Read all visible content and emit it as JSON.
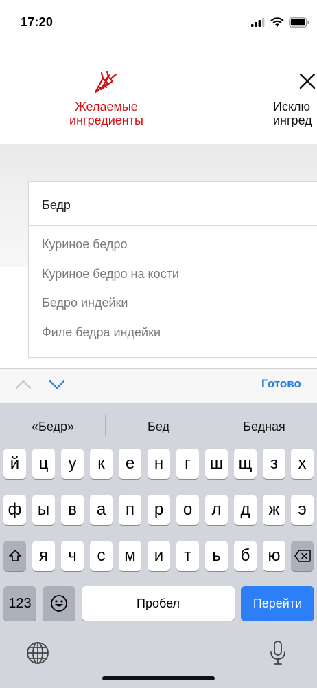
{
  "status_bar": {
    "time": "17:20"
  },
  "tabs": {
    "desired": {
      "line1": "Желаемые",
      "line2": "ингредиенты",
      "icon": "carrot-icon",
      "color": "#d50f12"
    },
    "exclude": {
      "line1": "Исклю",
      "line2": "ингред",
      "icon": "close-icon"
    }
  },
  "search": {
    "value": "Бедр",
    "suggestions": [
      "Куриное бедро",
      "Куриное бедро на кости",
      "Бедро индейки",
      "Филе бедра индейки"
    ]
  },
  "toolbar": {
    "done_label": "Готово",
    "accent": "#2a7be4"
  },
  "keyboard": {
    "predictions": [
      "«Бедр»",
      "Бед",
      "Бедная"
    ],
    "row1": [
      "й",
      "ц",
      "у",
      "к",
      "е",
      "н",
      "г",
      "ш",
      "щ",
      "з",
      "х"
    ],
    "row2": [
      "ф",
      "ы",
      "в",
      "а",
      "п",
      "р",
      "о",
      "л",
      "д",
      "ж",
      "э"
    ],
    "row3": [
      "я",
      "ч",
      "с",
      "м",
      "и",
      "т",
      "ь",
      "б",
      "ю"
    ],
    "numbers_label": "123",
    "space_label": "Пробел",
    "go_label": "Перейти",
    "go_color": "#2c7ff6"
  }
}
